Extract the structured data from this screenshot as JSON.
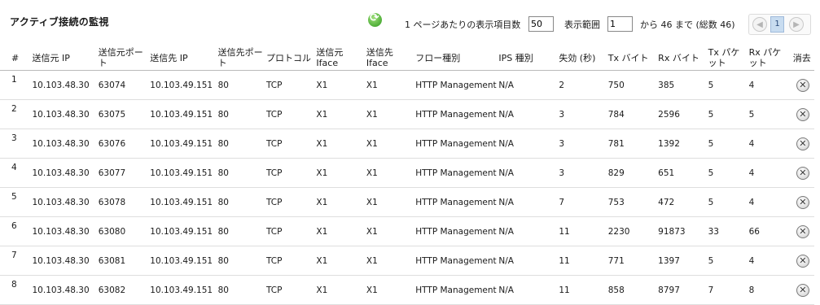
{
  "header": {
    "title": "アクティブ接続の監視",
    "per_page_label": "1 ページあたりの表示項目数",
    "per_page_value": "50",
    "range_label": "表示範囲",
    "range_start_value": "1",
    "range_suffix": "から 46 まで (総数 46)",
    "current_page": "1",
    "prev_icon": "◀",
    "next_icon": "▶"
  },
  "table": {
    "columns": [
      "#",
      "送信元 IP",
      "送信元ポート",
      "送信先 IP",
      "送信先ポート",
      "プロトコル",
      "送信元 Iface",
      "送信先 Iface",
      "フロー種別",
      "IPS 種別",
      "失効 (秒)",
      "Tx バイト",
      "Rx バイト",
      "Tx パケット",
      "Rx パケット",
      "消去"
    ],
    "rows": [
      [
        "1",
        "10.103.48.30",
        "63074",
        "10.103.49.151",
        "80",
        "TCP",
        "X1",
        "X1",
        "HTTP Management",
        "N/A",
        "2",
        "750",
        "385",
        "5",
        "4"
      ],
      [
        "2",
        "10.103.48.30",
        "63075",
        "10.103.49.151",
        "80",
        "TCP",
        "X1",
        "X1",
        "HTTP Management",
        "N/A",
        "3",
        "784",
        "2596",
        "5",
        "5"
      ],
      [
        "3",
        "10.103.48.30",
        "63076",
        "10.103.49.151",
        "80",
        "TCP",
        "X1",
        "X1",
        "HTTP Management",
        "N/A",
        "3",
        "781",
        "1392",
        "5",
        "4"
      ],
      [
        "4",
        "10.103.48.30",
        "63077",
        "10.103.49.151",
        "80",
        "TCP",
        "X1",
        "X1",
        "HTTP Management",
        "N/A",
        "3",
        "829",
        "651",
        "5",
        "4"
      ],
      [
        "5",
        "10.103.48.30",
        "63078",
        "10.103.49.151",
        "80",
        "TCP",
        "X1",
        "X1",
        "HTTP Management",
        "N/A",
        "7",
        "753",
        "472",
        "5",
        "4"
      ],
      [
        "6",
        "10.103.48.30",
        "63080",
        "10.103.49.151",
        "80",
        "TCP",
        "X1",
        "X1",
        "HTTP Management",
        "N/A",
        "11",
        "2230",
        "91873",
        "33",
        "66"
      ],
      [
        "7",
        "10.103.48.30",
        "63081",
        "10.103.49.151",
        "80",
        "TCP",
        "X1",
        "X1",
        "HTTP Management",
        "N/A",
        "11",
        "771",
        "1397",
        "5",
        "4"
      ],
      [
        "8",
        "10.103.48.30",
        "63082",
        "10.103.49.151",
        "80",
        "TCP",
        "X1",
        "X1",
        "HTTP Management",
        "N/A",
        "11",
        "858",
        "8797",
        "7",
        "8"
      ]
    ],
    "delete_icon": "✕"
  },
  "colors": {
    "page_highlight": "#c8dcf0",
    "refresh_green": "#2e9a1e"
  }
}
